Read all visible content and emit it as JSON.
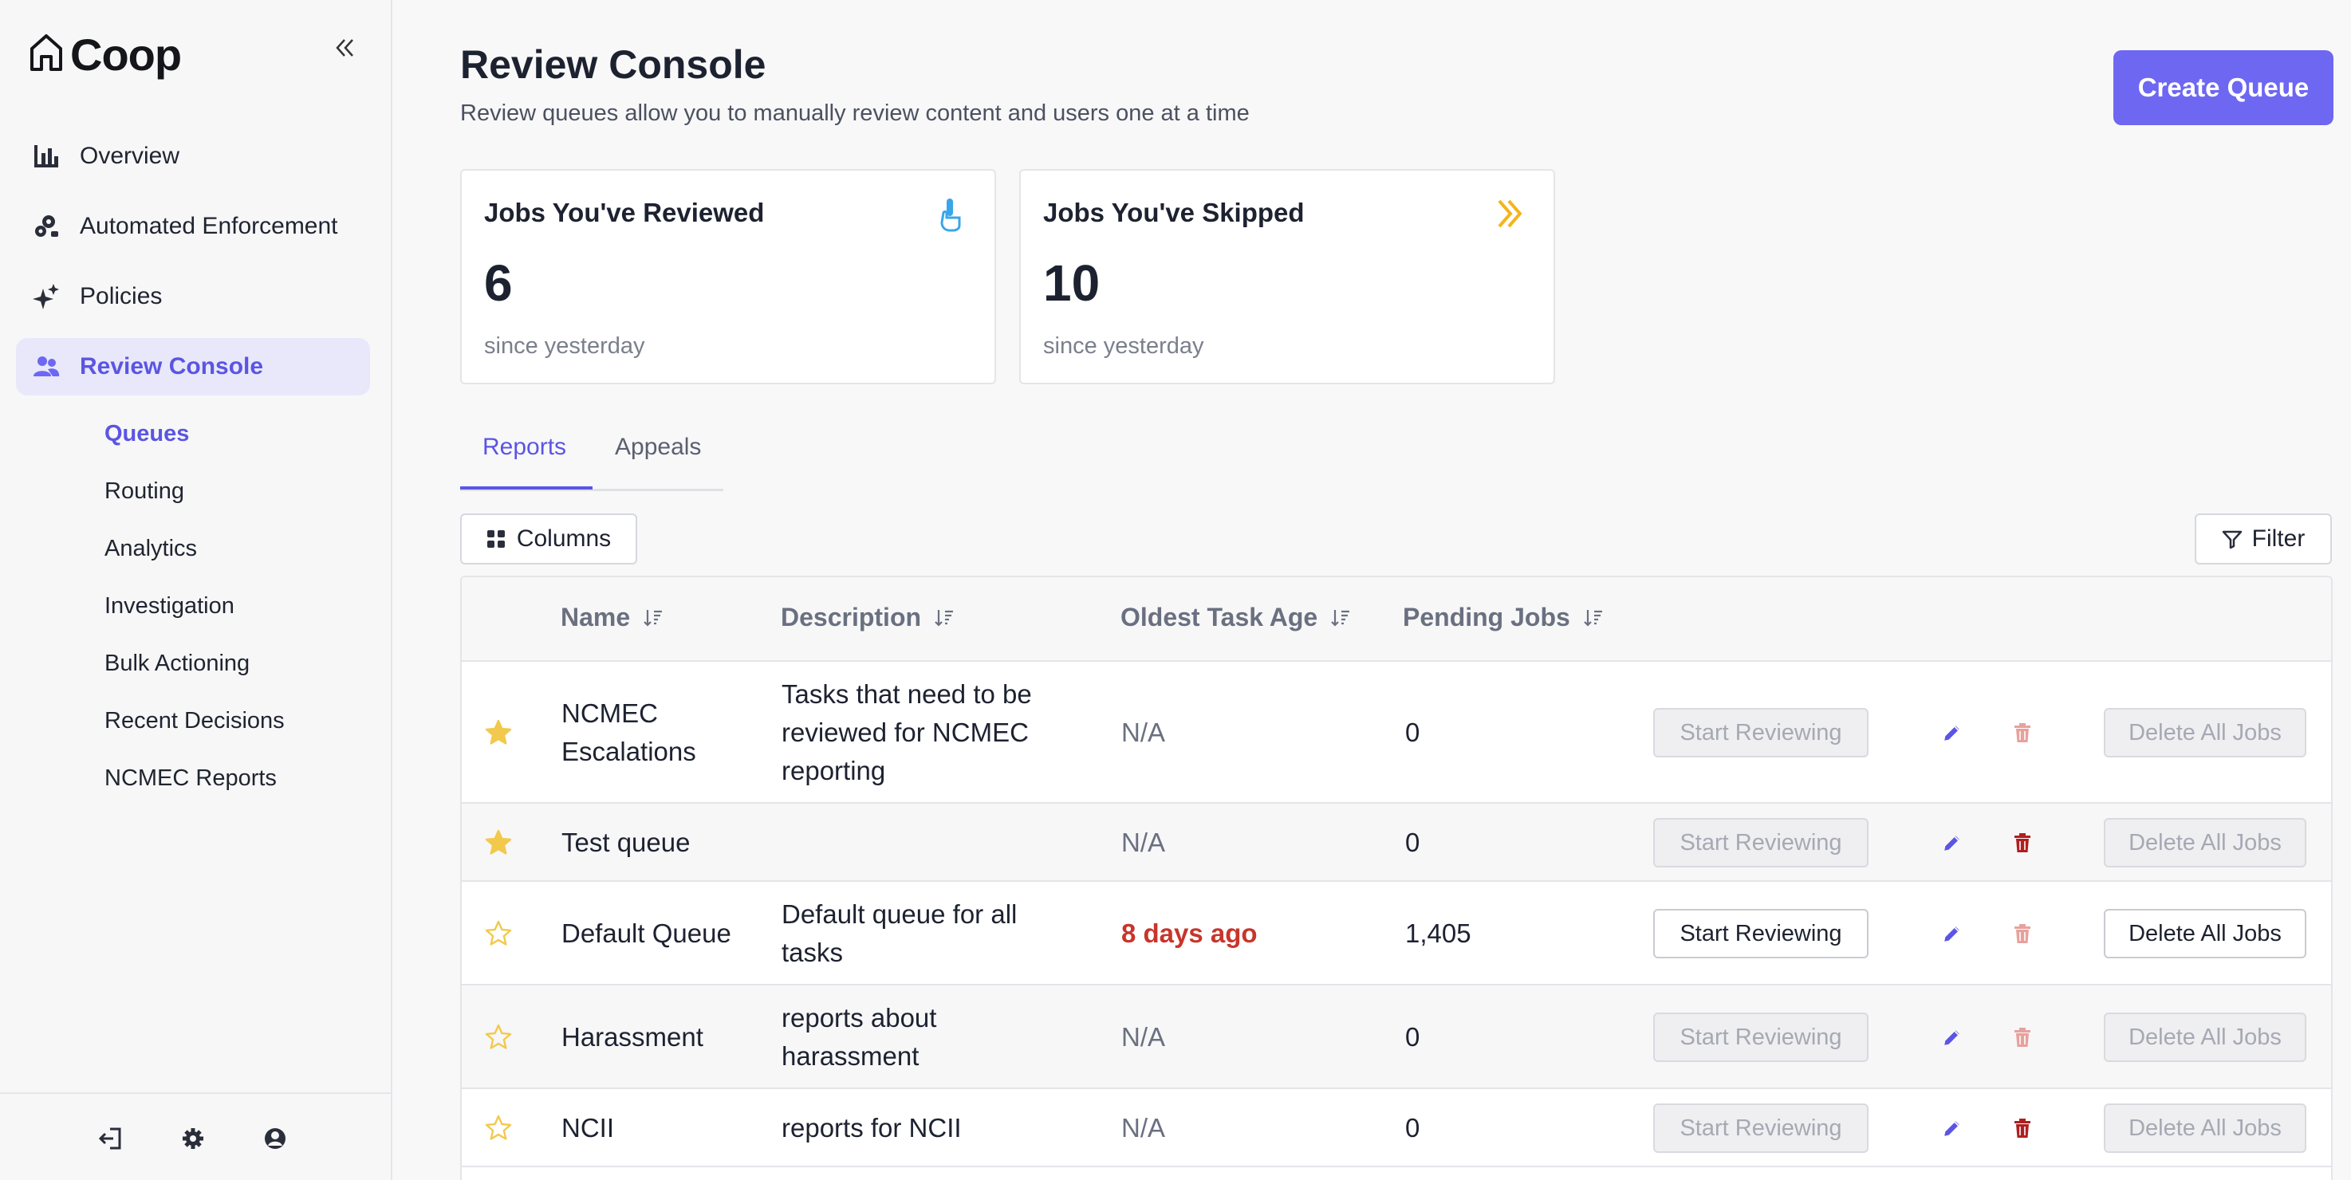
{
  "app": {
    "name": "Coop"
  },
  "sidebar": {
    "items": [
      {
        "label": "Overview",
        "icon": "bar-chart-icon"
      },
      {
        "label": "Automated Enforcement",
        "icon": "cogs-icon"
      },
      {
        "label": "Policies",
        "icon": "sparkle-icon"
      },
      {
        "label": "Review Console",
        "icon": "users-icon",
        "active": true
      }
    ],
    "subitems": [
      {
        "label": "Queues",
        "active": true
      },
      {
        "label": "Routing"
      },
      {
        "label": "Analytics"
      },
      {
        "label": "Investigation"
      },
      {
        "label": "Bulk Actioning"
      },
      {
        "label": "Recent Decisions"
      },
      {
        "label": "NCMEC Reports"
      }
    ]
  },
  "header": {
    "title": "Review Console",
    "subtitle": "Review queues allow you to manually review content and users one at a time",
    "create_label": "Create Queue"
  },
  "stats": [
    {
      "title": "Jobs You've Reviewed",
      "value": "6",
      "note": "since yesterday",
      "icon": "pointer-hand-icon",
      "icon_color": "#3aa6e8"
    },
    {
      "title": "Jobs You've Skipped",
      "value": "10",
      "note": "since yesterday",
      "icon": "double-chevron-right-icon",
      "icon_color": "#f2b51c"
    }
  ],
  "tabs": [
    {
      "label": "Reports",
      "active": true
    },
    {
      "label": "Appeals"
    }
  ],
  "toolbar": {
    "columns_label": "Columns",
    "filter_label": "Filter"
  },
  "table": {
    "headers": [
      "Name",
      "Description",
      "Oldest Task Age",
      "Pending Jobs"
    ],
    "rows": [
      {
        "starred": true,
        "name": "NCMEC Escalations",
        "description": "Tasks that need to be reviewed for NCMEC reporting",
        "age": "N/A",
        "pending": "0",
        "start_label": "Start Reviewing",
        "start_enabled": false,
        "trash_color": "#e7a19c",
        "delete_label": "Delete All Jobs",
        "delete_enabled": false
      },
      {
        "starred": true,
        "name": "Test queue",
        "description": "",
        "age": "N/A",
        "pending": "0",
        "start_label": "Start Reviewing",
        "start_enabled": false,
        "trash_color": "#b01f1f",
        "delete_label": "Delete All Jobs",
        "delete_enabled": false
      },
      {
        "starred": false,
        "name": "Default Queue",
        "description": "Default queue for all tasks",
        "age": "8 days ago",
        "age_warning": true,
        "pending": "1,405",
        "start_label": "Start Reviewing",
        "start_enabled": true,
        "trash_color": "#e7a19c",
        "delete_label": "Delete All Jobs",
        "delete_enabled": true
      },
      {
        "starred": false,
        "name": "Harassment",
        "description": "reports about harassment",
        "age": "N/A",
        "pending": "0",
        "start_label": "Start Reviewing",
        "start_enabled": false,
        "trash_color": "#e7a19c",
        "delete_label": "Delete All Jobs",
        "delete_enabled": false
      },
      {
        "starred": false,
        "name": "NCII",
        "description": "reports for NCII",
        "age": "N/A",
        "pending": "0",
        "start_label": "Start Reviewing",
        "start_enabled": false,
        "trash_color": "#b01f1f",
        "delete_label": "Delete All Jobs",
        "delete_enabled": false
      }
    ]
  },
  "colors": {
    "accent": "#6e67f2",
    "accent_text": "#5b55e3",
    "star": "#f2c94c",
    "edit": "#5b55e3",
    "warning": "#c8352b"
  }
}
